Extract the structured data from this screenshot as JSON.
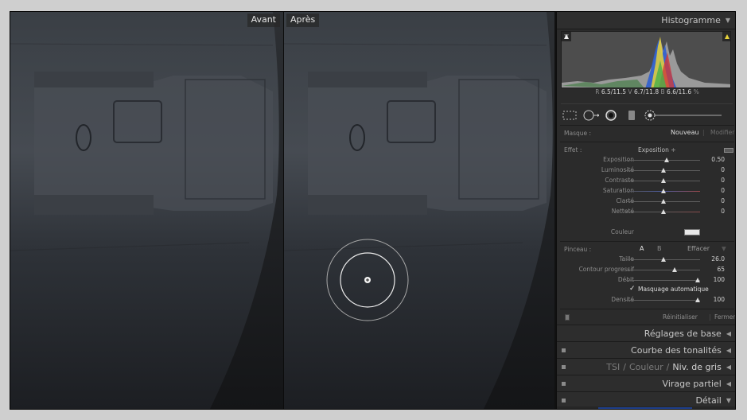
{
  "before_label": "Avant",
  "after_label": "Après",
  "histogram": {
    "title": "Histogramme",
    "readout": {
      "r_label": "R",
      "r_value": "6.5/11.5",
      "v_label": "V",
      "v_value": "6.7/11.8",
      "b_label": "B",
      "b_value": "6.6/11.6",
      "unit": "%"
    }
  },
  "mask": {
    "label": "Masque :",
    "new": "Nouveau",
    "edit": "Modifier"
  },
  "effect": {
    "label": "Effet :",
    "preset": "Exposition ÷",
    "sliders": [
      {
        "label": "Exposition",
        "value": "0.50"
      },
      {
        "label": "Luminosité",
        "value": "0"
      },
      {
        "label": "Contraste",
        "value": "0"
      },
      {
        "label": "Saturation",
        "value": "0"
      },
      {
        "label": "Clarté",
        "value": "0"
      },
      {
        "label": "Netteté",
        "value": "0"
      }
    ],
    "color_label": "Couleur"
  },
  "brush": {
    "label": "Pinceau :",
    "a": "A",
    "b": "B",
    "erase": "Effacer",
    "sliders": [
      {
        "label": "Taille",
        "value": "26.0"
      },
      {
        "label": "Contour progressif",
        "value": "65"
      },
      {
        "label": "Débit",
        "value": "100"
      }
    ],
    "auto_mask_check": "✓",
    "auto_mask": "Masquage automatique",
    "density_label": "Densité",
    "density_value": "100"
  },
  "footer": {
    "reset": "Réinitialiser",
    "close": "Fermer"
  },
  "sections": {
    "basic": "Réglages de base",
    "tone_curve": "Courbe des tonalités",
    "hsl": "TSI",
    "hsl_sep1": "/",
    "color": "Couleur",
    "hsl_sep2": "/",
    "grayscale": "Niv. de gris",
    "split": "Virage partiel",
    "detail": "Détail"
  },
  "colors": {
    "accent_yellow": "#e6d23a",
    "panel_bg": "#2b2b2b",
    "photo_bg": "#2a2d31"
  },
  "icons": [
    "marquee-icon",
    "spot-removal-icon",
    "red-eye-icon",
    "graduated-filter-icon",
    "adjustment-brush-icon",
    "triangle-down-icon",
    "triangle-left-icon"
  ]
}
